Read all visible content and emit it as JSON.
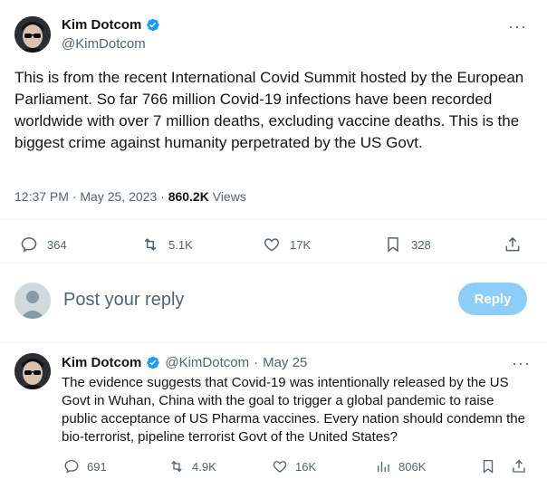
{
  "main_tweet": {
    "author_name": "Kim Dotcom",
    "author_handle": "@KimDotcom",
    "more_icon": "more-horizontal-icon",
    "text": "This is from the recent International Covid Summit hosted by the European Parliament. So far 766 million Covid-19 infections have been recorded worldwide with over 7 million deaths, excluding vaccine deaths. This is the biggest crime against humanity perpetrated by the US Govt.",
    "time": "12:37 PM",
    "separator": "·",
    "date": "May 25, 2023",
    "views_count": "860.2K",
    "views_label": "Views",
    "stats": {
      "replies": "364",
      "retweets": "5.1K",
      "likes": "17K",
      "bookmarks": "328"
    }
  },
  "reply_box": {
    "placeholder": "Post your reply",
    "button_label": "Reply"
  },
  "second_tweet": {
    "author_name": "Kim Dotcom",
    "author_handle": "@KimDotcom",
    "separator": "·",
    "date": "May 25",
    "text": "The evidence suggests that Covid-19 was intentionally released by the US Govt in Wuhan, China with the goal to trigger a global pandemic to raise public acceptance of US Pharma vaccines. Every nation should condemn the bio-terrorist, pipeline terrorist Govt of the United States?",
    "stats": {
      "replies": "691",
      "retweets": "4.9K",
      "likes": "16K",
      "views": "806K"
    }
  },
  "colors": {
    "accent": "#1d9bf0",
    "reply_button_disabled": "#8ecdf8",
    "secondary_text": "#536471",
    "primary_text": "#0f1419",
    "divider": "#eff3f4"
  }
}
